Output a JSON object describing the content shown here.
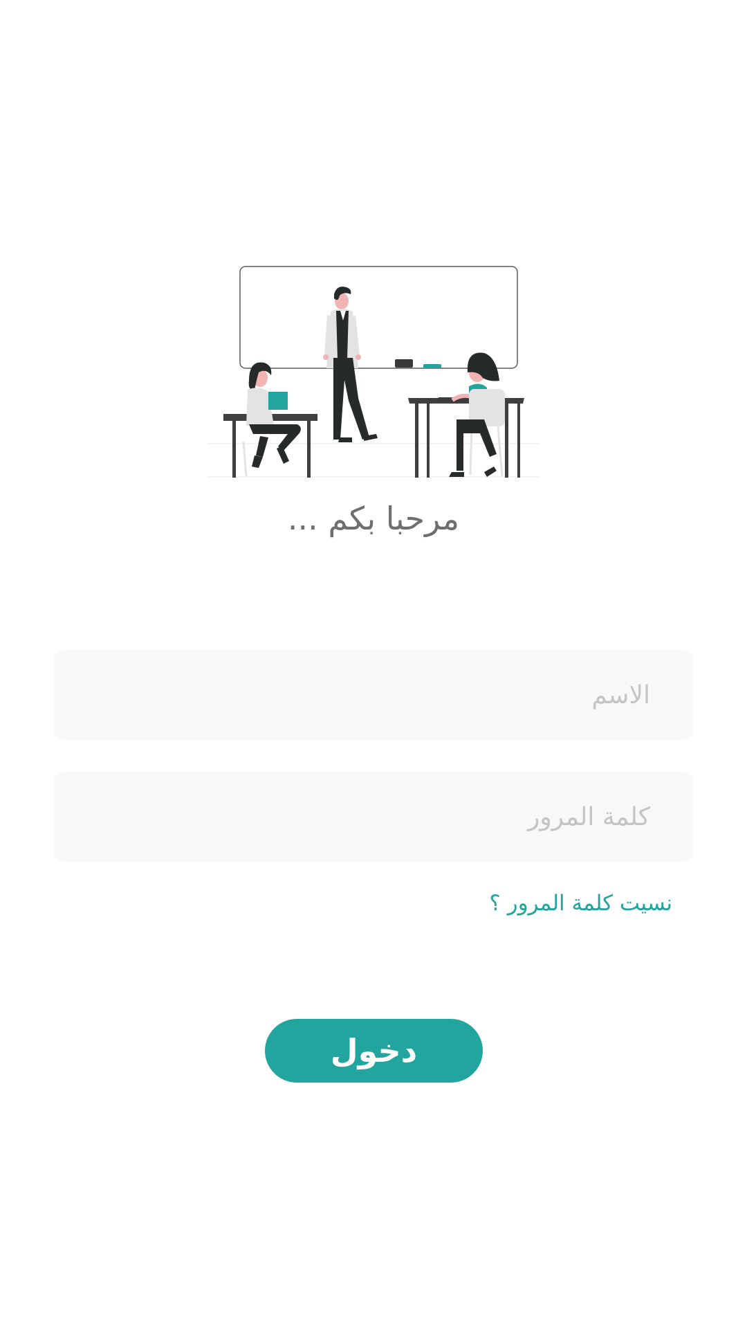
{
  "welcome": {
    "title": "مرحبا بكم ..."
  },
  "form": {
    "name_placeholder": "الاسم",
    "name_value": "",
    "password_placeholder": "كلمة المرور",
    "password_value": "",
    "forgot_password_label": "نسيت كلمة المرور ؟",
    "login_label": "دخول"
  },
  "illustration": {
    "icon": "classroom-illustration"
  },
  "colors": {
    "accent": "#22a59f",
    "field_background": "#f8f8f8",
    "title_text": "#6e6e6e",
    "placeholder_text": "#c4c4c4"
  }
}
